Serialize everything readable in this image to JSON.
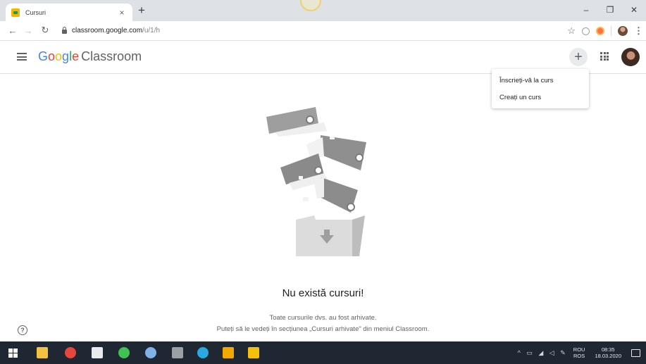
{
  "browser": {
    "tab_title": "Cursuri",
    "tab_close": "×",
    "new_tab": "+",
    "url_host": "classroom.google.com",
    "url_path": "/u/1/h",
    "window_controls": {
      "minimize": "–",
      "restore": "❐",
      "close": "✕"
    }
  },
  "header": {
    "brand_google": [
      "G",
      "o",
      "o",
      "g",
      "l",
      "e"
    ],
    "brand_product": "Classroom",
    "plus_label": "+"
  },
  "menu": {
    "items": [
      {
        "label": "Înscrieți-vă la curs"
      },
      {
        "label": "Creați un curs"
      }
    ]
  },
  "empty_state": {
    "title": "Nu există cursuri!",
    "line1": "Toate cursurile dvs. au fost arhivate.",
    "line2": "Puteți să le vedeți în secțiunea „Cursuri arhivate\" din meniul Classroom."
  },
  "help": {
    "glyph": "?"
  },
  "taskbar": {
    "tray_icons": "^ ▭ ◢ ◁ ✎",
    "lang_top": "ROU",
    "lang_bottom": "ROS",
    "time": "08:35",
    "date": "18.03.2020",
    "apps": [
      {
        "name": "file-explorer",
        "color": "#f4c242"
      },
      {
        "name": "chrome",
        "color": "#e8453c"
      },
      {
        "name": "chat",
        "color": "#e8eaed"
      },
      {
        "name": "whatsapp",
        "color": "#41c352"
      },
      {
        "name": "teamviewer",
        "color": "#7fb2e6"
      },
      {
        "name": "settings",
        "color": "#9aa0a6"
      },
      {
        "name": "rss",
        "color": "#2aa8e0"
      },
      {
        "name": "library",
        "color": "#f2a900"
      },
      {
        "name": "arrows",
        "color": "#f4c20d"
      }
    ]
  },
  "colors": {
    "accent_google_blue": "#4285f4",
    "header_border": "#e0e0e0",
    "taskbar": "#1f2733"
  }
}
